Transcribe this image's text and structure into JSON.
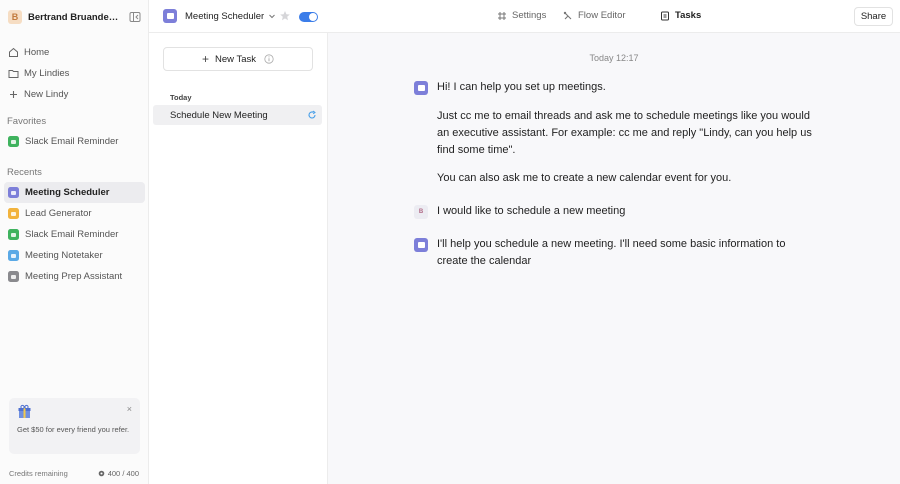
{
  "sidebar": {
    "workspace": {
      "avatar": "B",
      "name": "Bertrand Bruandet's..."
    },
    "nav": [
      {
        "label": "Home",
        "icon": "home-icon"
      },
      {
        "label": "My Lindies",
        "icon": "folder-icon"
      },
      {
        "label": "New Lindy",
        "icon": "plus-icon"
      }
    ],
    "favorites_label": "Favorites",
    "favorites": [
      {
        "label": "Slack Email Reminder",
        "color": "#3fb35e"
      }
    ],
    "recents_label": "Recents",
    "recents": [
      {
        "label": "Meeting Scheduler",
        "color": "#7d7fd9",
        "active": true
      },
      {
        "label": "Lead Generator",
        "color": "#f2b33d"
      },
      {
        "label": "Slack Email Reminder",
        "color": "#3fb35e"
      },
      {
        "label": "Meeting Notetaker",
        "color": "#5aa9e6"
      },
      {
        "label": "Meeting Prep Assistant",
        "color": "#8a8a8e"
      }
    ],
    "promo": {
      "text": "Get $50 for every friend you refer.",
      "close": "×"
    },
    "credits": {
      "label": "Credits remaining",
      "value": "400 / 400"
    }
  },
  "topbar": {
    "agent_name": "Meeting Scheduler",
    "agent_enabled": true,
    "tabs": [
      {
        "label": "Settings",
        "icon": "settings-grid-icon"
      },
      {
        "label": "Flow Editor",
        "icon": "flow-icon"
      },
      {
        "label": "Tasks",
        "icon": "tasks-icon",
        "active": true
      }
    ],
    "share_label": "Share"
  },
  "tasks": {
    "new_task_label": "New Task",
    "group_label": "Today",
    "items": [
      {
        "label": "Schedule New Meeting"
      }
    ]
  },
  "chat": {
    "timestamp": "Today 12:17",
    "messages": [
      {
        "from": "agent",
        "text": "Hi! I can help you set up meetings."
      },
      {
        "from": "agent",
        "text": "Just cc me to email threads and ask me to schedule meetings like you would an executive assistant. For example: cc me and reply \"Lindy, can you help us find some time\"."
      },
      {
        "from": "agent",
        "text": "You can also ask me to create a new calendar event for you."
      },
      {
        "from": "user",
        "avatar": "B",
        "text": "I would like to schedule a new meeting"
      },
      {
        "from": "agent",
        "text": "I'll help you schedule a new meeting. I'll need some basic information to create the calendar"
      }
    ]
  },
  "colors": {
    "accent": "#3b7de9",
    "agent": "#7d7fd9"
  }
}
